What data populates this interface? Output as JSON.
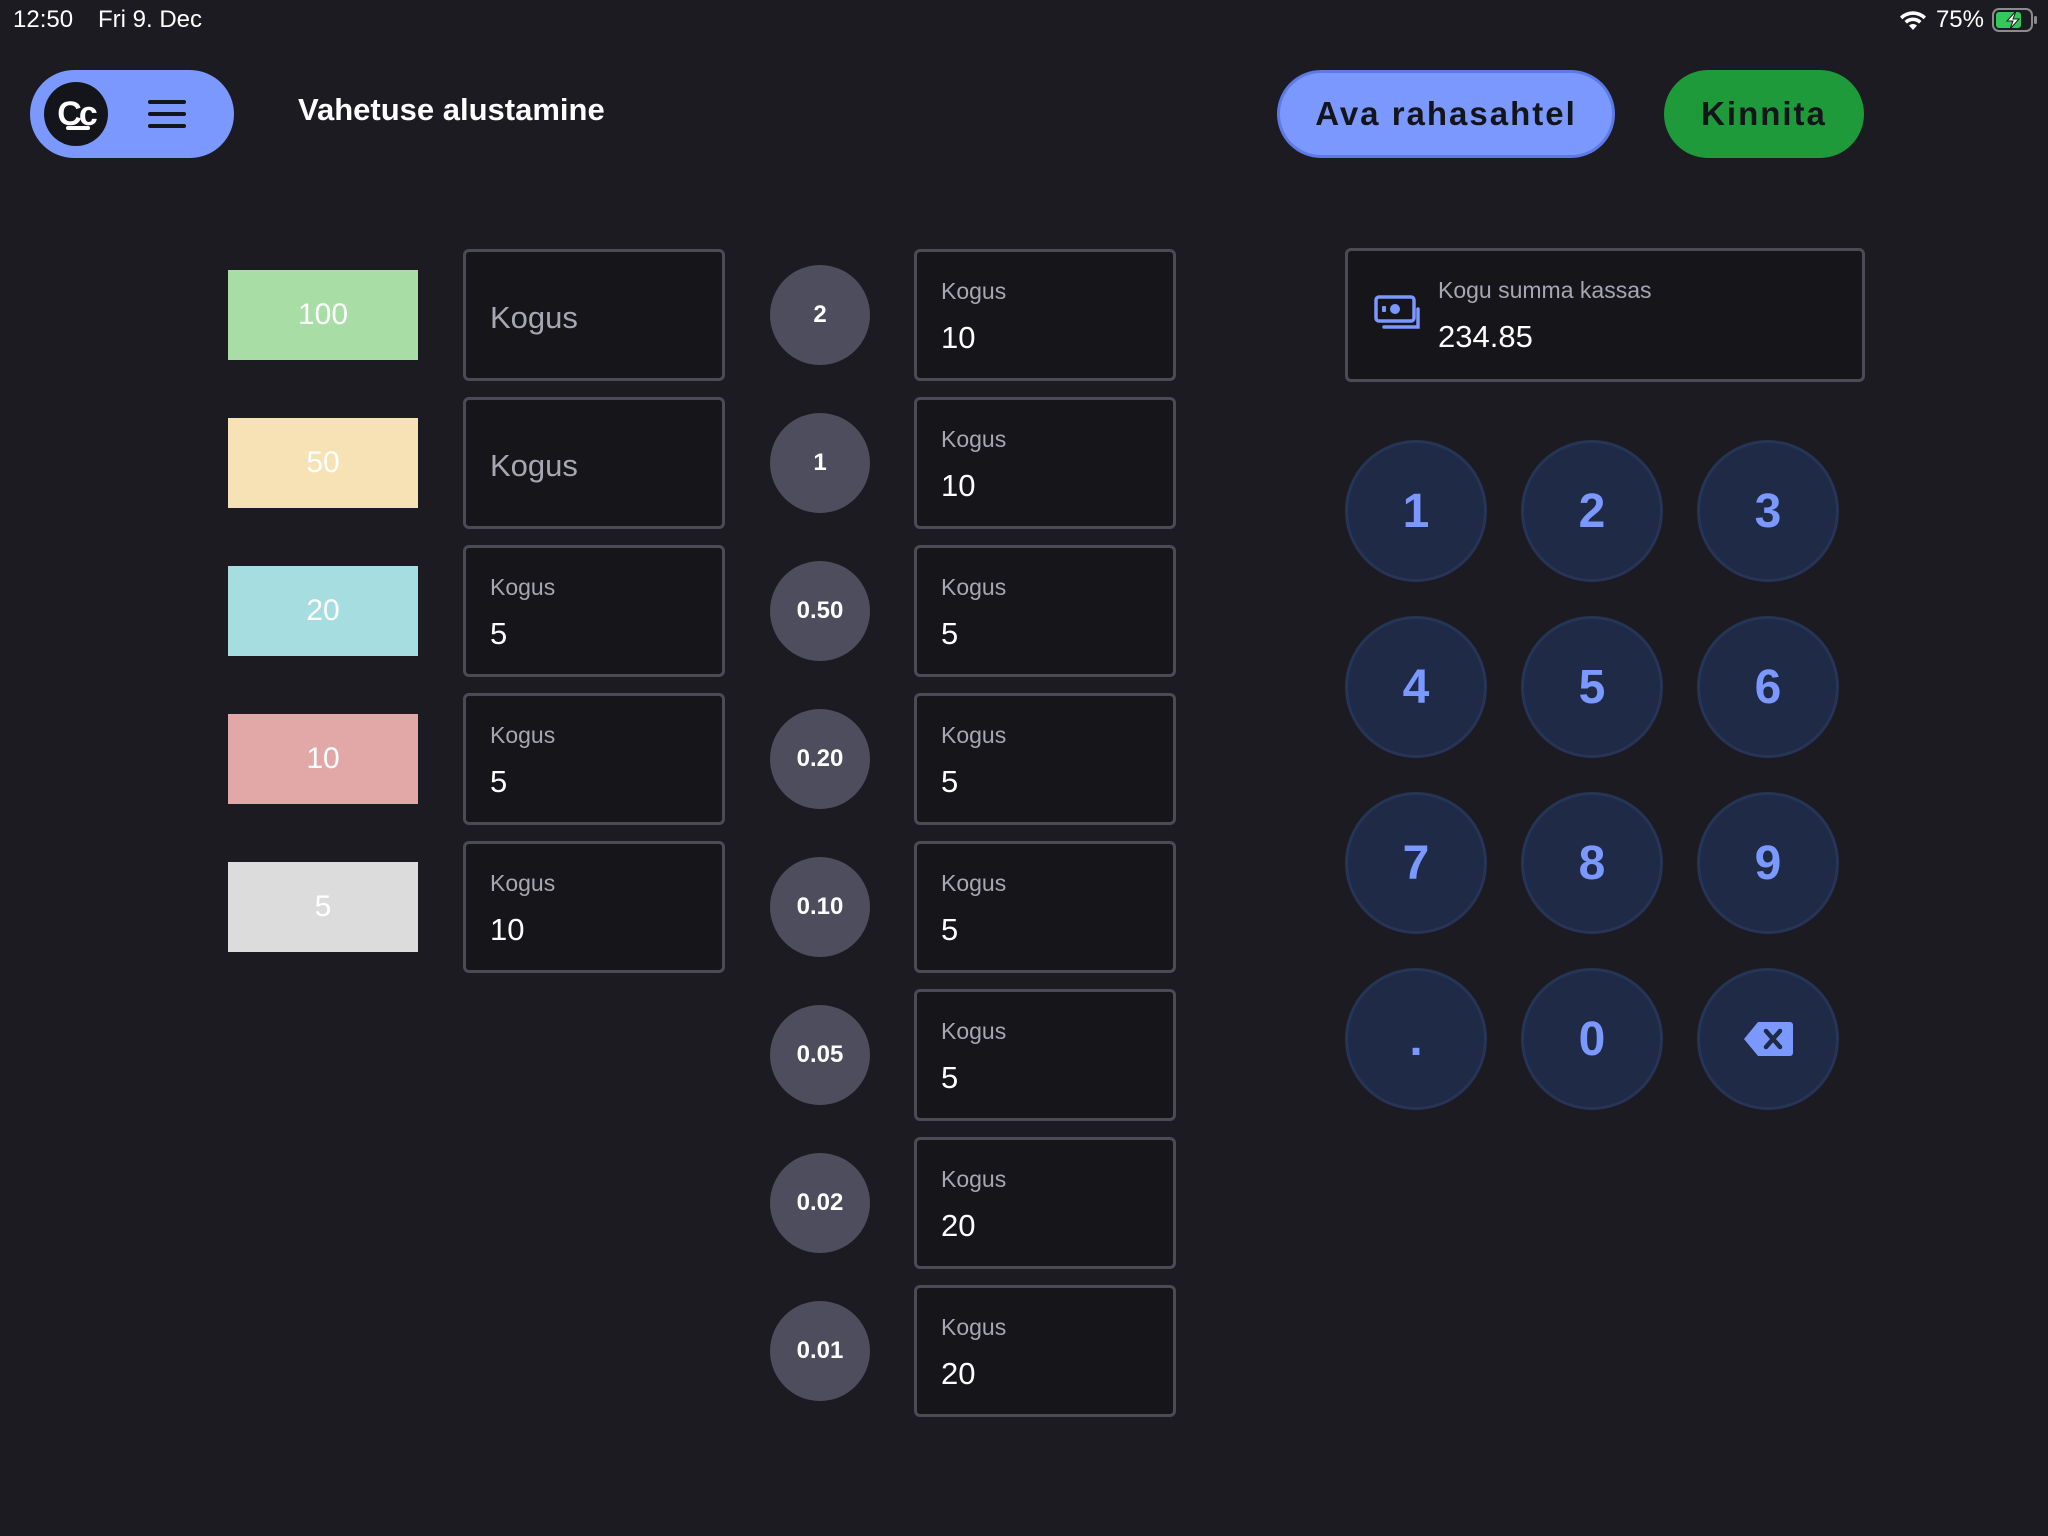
{
  "status_bar": {
    "time": "12:50",
    "date": "Fri 9. Dec",
    "battery": "75%"
  },
  "header": {
    "logo_text": "Cc",
    "title": "Vahetuse alustamine",
    "open_drawer_label": "Ava rahasahtel",
    "confirm_label": "Kinnita"
  },
  "field_label": "Kogus",
  "bills": [
    {
      "value": "100",
      "color": "#a8dea6",
      "quantity": ""
    },
    {
      "value": "50",
      "color": "#f6e2b4",
      "quantity": ""
    },
    {
      "value": "20",
      "color": "#a6dde0",
      "quantity": "5"
    },
    {
      "value": "10",
      "color": "#e2a7a7",
      "quantity": "5"
    },
    {
      "value": "5",
      "color": "#dcdcdc",
      "quantity": "10"
    }
  ],
  "coins": [
    {
      "value": "2",
      "quantity": "10"
    },
    {
      "value": "1",
      "quantity": "10"
    },
    {
      "value": "0.50",
      "quantity": "5"
    },
    {
      "value": "0.20",
      "quantity": "5"
    },
    {
      "value": "0.10",
      "quantity": "5"
    },
    {
      "value": "0.05",
      "quantity": "5"
    },
    {
      "value": "0.02",
      "quantity": "20"
    },
    {
      "value": "0.01",
      "quantity": "20"
    }
  ],
  "total": {
    "label": "Kogu summa kassas",
    "value": "234.85",
    "icon": "money-icon"
  },
  "keypad": [
    "1",
    "2",
    "3",
    "4",
    "5",
    "6",
    "7",
    "8",
    "9",
    ".",
    "0",
    "backspace"
  ],
  "colors": {
    "accent": "#7b98ff",
    "confirm": "#1e9a3a",
    "background": "#1b1b21",
    "key_bg": "#1f2a46"
  }
}
